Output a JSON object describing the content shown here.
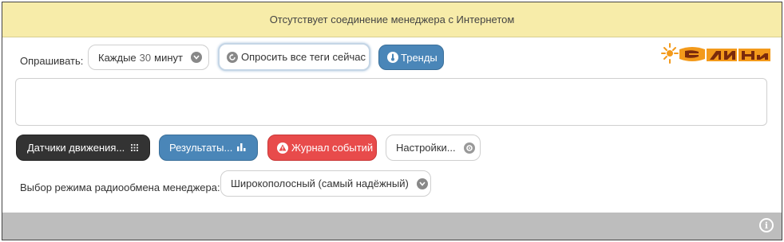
{
  "banner": {
    "text": "Отсутствует соединение менеджера с Интернетом"
  },
  "poll": {
    "label": "Опрашивать:",
    "interval_prefix": "Каждые",
    "interval_value": "30",
    "interval_suffix": "минут",
    "poll_now_label": "Опросить все теги сейчас",
    "trends_label": "Тренды"
  },
  "nav": {
    "sensors_label": "Датчики движения...",
    "results_label": "Результаты...",
    "events_label": "Журнал событий",
    "settings_label": "Настройки..."
  },
  "radio": {
    "label": "Выбор режима радиообмена менеджера:",
    "mode_value": "Широкополосный (самый надёжный)"
  },
  "colors": {
    "banner_bg": "#f7eca9",
    "dark": "#333333",
    "blue": "#4a86b8",
    "red": "#e84b4b",
    "footer": "#bdbdbd",
    "logo_orange": "#f39a1b"
  },
  "icons": {
    "dropdown": "chevron-down-icon",
    "refresh": "refresh-icon",
    "thermometer": "thermometer-icon",
    "grid": "grid-icon",
    "bar_chart": "bar-chart-icon",
    "warning": "warning-icon",
    "gear": "gear-icon",
    "info": "info-icon"
  }
}
